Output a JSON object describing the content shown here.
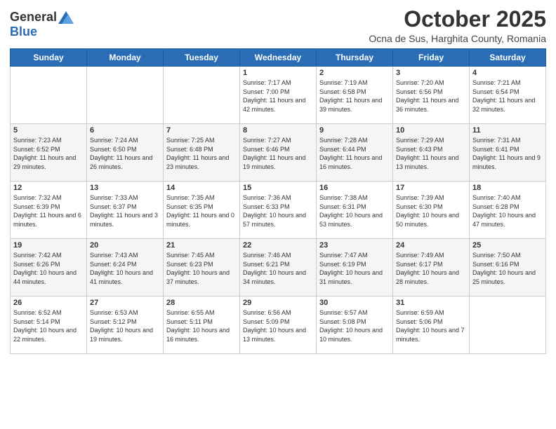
{
  "logo": {
    "general": "General",
    "blue": "Blue"
  },
  "header": {
    "month": "October 2025",
    "location": "Ocna de Sus, Harghita County, Romania"
  },
  "days_of_week": [
    "Sunday",
    "Monday",
    "Tuesday",
    "Wednesday",
    "Thursday",
    "Friday",
    "Saturday"
  ],
  "weeks": [
    [
      {
        "day": "",
        "info": ""
      },
      {
        "day": "",
        "info": ""
      },
      {
        "day": "",
        "info": ""
      },
      {
        "day": "1",
        "info": "Sunrise: 7:17 AM\nSunset: 7:00 PM\nDaylight: 11 hours and 42 minutes."
      },
      {
        "day": "2",
        "info": "Sunrise: 7:19 AM\nSunset: 6:58 PM\nDaylight: 11 hours and 39 minutes."
      },
      {
        "day": "3",
        "info": "Sunrise: 7:20 AM\nSunset: 6:56 PM\nDaylight: 11 hours and 36 minutes."
      },
      {
        "day": "4",
        "info": "Sunrise: 7:21 AM\nSunset: 6:54 PM\nDaylight: 11 hours and 32 minutes."
      }
    ],
    [
      {
        "day": "5",
        "info": "Sunrise: 7:23 AM\nSunset: 6:52 PM\nDaylight: 11 hours and 29 minutes."
      },
      {
        "day": "6",
        "info": "Sunrise: 7:24 AM\nSunset: 6:50 PM\nDaylight: 11 hours and 26 minutes."
      },
      {
        "day": "7",
        "info": "Sunrise: 7:25 AM\nSunset: 6:48 PM\nDaylight: 11 hours and 23 minutes."
      },
      {
        "day": "8",
        "info": "Sunrise: 7:27 AM\nSunset: 6:46 PM\nDaylight: 11 hours and 19 minutes."
      },
      {
        "day": "9",
        "info": "Sunrise: 7:28 AM\nSunset: 6:44 PM\nDaylight: 11 hours and 16 minutes."
      },
      {
        "day": "10",
        "info": "Sunrise: 7:29 AM\nSunset: 6:43 PM\nDaylight: 11 hours and 13 minutes."
      },
      {
        "day": "11",
        "info": "Sunrise: 7:31 AM\nSunset: 6:41 PM\nDaylight: 11 hours and 9 minutes."
      }
    ],
    [
      {
        "day": "12",
        "info": "Sunrise: 7:32 AM\nSunset: 6:39 PM\nDaylight: 11 hours and 6 minutes."
      },
      {
        "day": "13",
        "info": "Sunrise: 7:33 AM\nSunset: 6:37 PM\nDaylight: 11 hours and 3 minutes."
      },
      {
        "day": "14",
        "info": "Sunrise: 7:35 AM\nSunset: 6:35 PM\nDaylight: 11 hours and 0 minutes."
      },
      {
        "day": "15",
        "info": "Sunrise: 7:36 AM\nSunset: 6:33 PM\nDaylight: 10 hours and 57 minutes."
      },
      {
        "day": "16",
        "info": "Sunrise: 7:38 AM\nSunset: 6:31 PM\nDaylight: 10 hours and 53 minutes."
      },
      {
        "day": "17",
        "info": "Sunrise: 7:39 AM\nSunset: 6:30 PM\nDaylight: 10 hours and 50 minutes."
      },
      {
        "day": "18",
        "info": "Sunrise: 7:40 AM\nSunset: 6:28 PM\nDaylight: 10 hours and 47 minutes."
      }
    ],
    [
      {
        "day": "19",
        "info": "Sunrise: 7:42 AM\nSunset: 6:26 PM\nDaylight: 10 hours and 44 minutes."
      },
      {
        "day": "20",
        "info": "Sunrise: 7:43 AM\nSunset: 6:24 PM\nDaylight: 10 hours and 41 minutes."
      },
      {
        "day": "21",
        "info": "Sunrise: 7:45 AM\nSunset: 6:23 PM\nDaylight: 10 hours and 37 minutes."
      },
      {
        "day": "22",
        "info": "Sunrise: 7:46 AM\nSunset: 6:21 PM\nDaylight: 10 hours and 34 minutes."
      },
      {
        "day": "23",
        "info": "Sunrise: 7:47 AM\nSunset: 6:19 PM\nDaylight: 10 hours and 31 minutes."
      },
      {
        "day": "24",
        "info": "Sunrise: 7:49 AM\nSunset: 6:17 PM\nDaylight: 10 hours and 28 minutes."
      },
      {
        "day": "25",
        "info": "Sunrise: 7:50 AM\nSunset: 6:16 PM\nDaylight: 10 hours and 25 minutes."
      }
    ],
    [
      {
        "day": "26",
        "info": "Sunrise: 6:52 AM\nSunset: 5:14 PM\nDaylight: 10 hours and 22 minutes."
      },
      {
        "day": "27",
        "info": "Sunrise: 6:53 AM\nSunset: 5:12 PM\nDaylight: 10 hours and 19 minutes."
      },
      {
        "day": "28",
        "info": "Sunrise: 6:55 AM\nSunset: 5:11 PM\nDaylight: 10 hours and 16 minutes."
      },
      {
        "day": "29",
        "info": "Sunrise: 6:56 AM\nSunset: 5:09 PM\nDaylight: 10 hours and 13 minutes."
      },
      {
        "day": "30",
        "info": "Sunrise: 6:57 AM\nSunset: 5:08 PM\nDaylight: 10 hours and 10 minutes."
      },
      {
        "day": "31",
        "info": "Sunrise: 6:59 AM\nSunset: 5:06 PM\nDaylight: 10 hours and 7 minutes."
      },
      {
        "day": "",
        "info": ""
      }
    ]
  ]
}
